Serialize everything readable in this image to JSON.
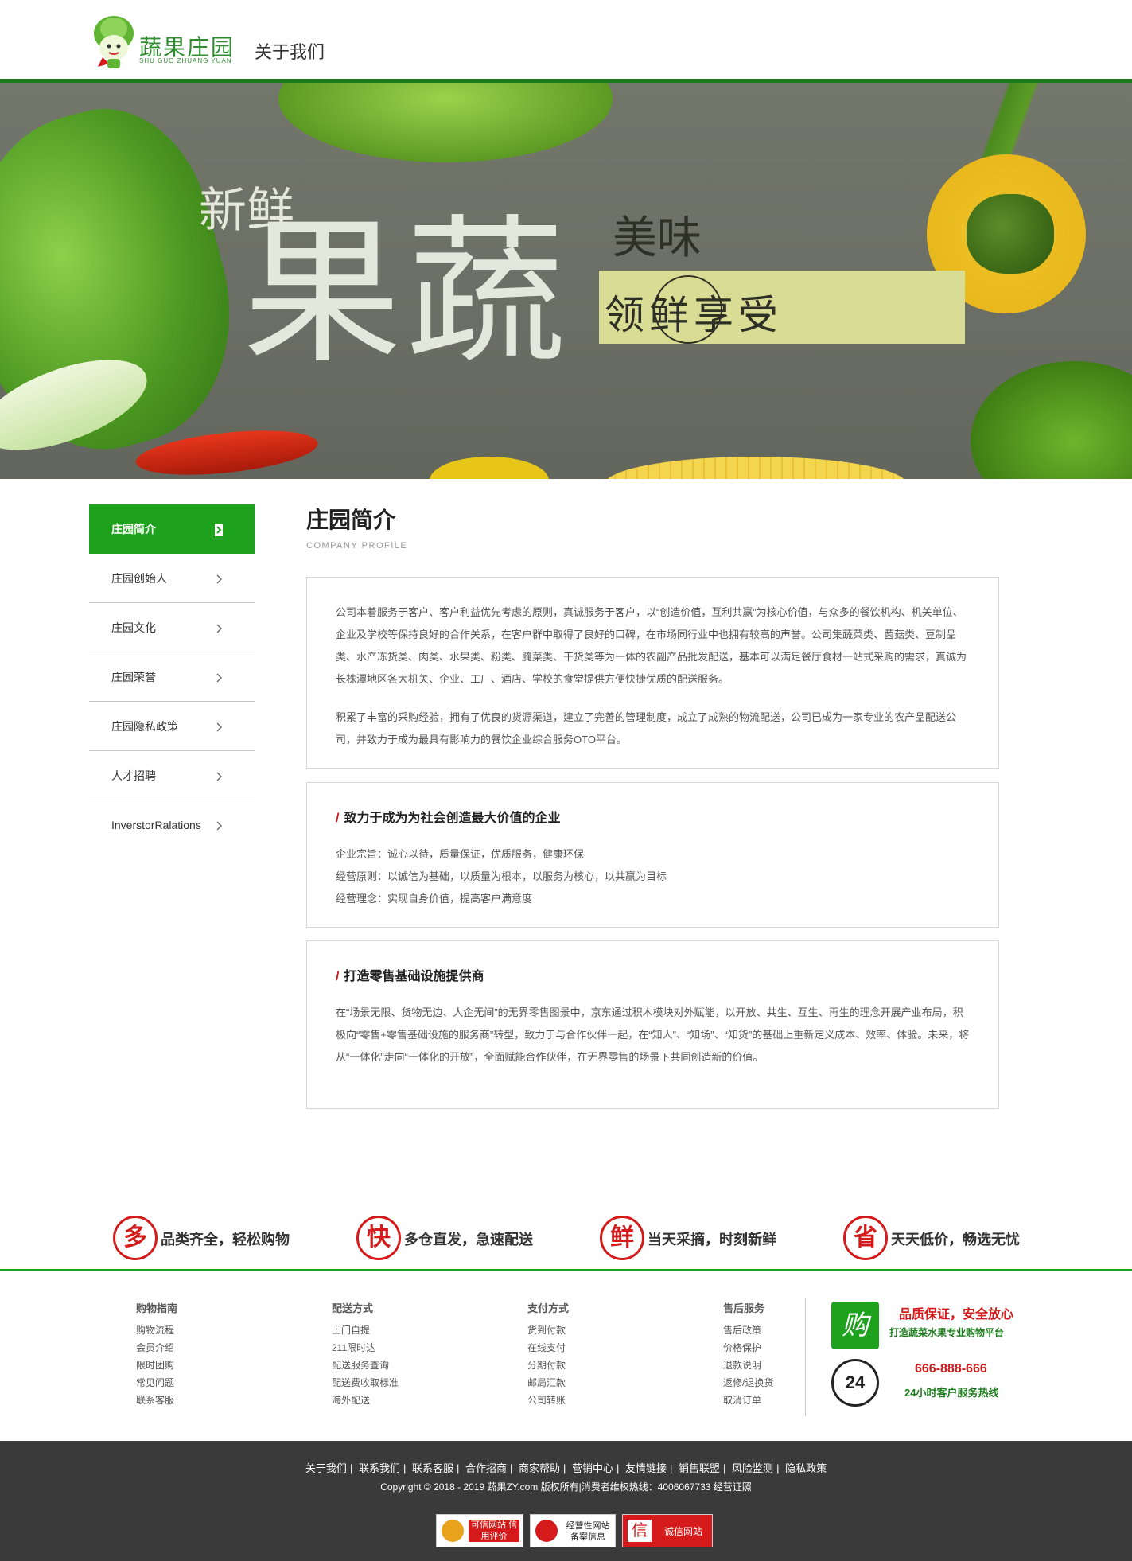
{
  "header": {
    "logo_text": "蔬果庄园",
    "logo_sub": "SHU GUO ZHUANG YUAN",
    "title": "关于我们"
  },
  "banner": {
    "line1": "新鲜",
    "line2": "果蔬",
    "line3": "美味",
    "slogan": "领鲜享受"
  },
  "sidebar": {
    "items": [
      {
        "label": "庄园简介",
        "active": true
      },
      {
        "label": "庄园创始人"
      },
      {
        "label": "庄园文化"
      },
      {
        "label": "庄园荣誉"
      },
      {
        "label": "庄园隐私政策"
      },
      {
        "label": "人才招聘"
      },
      {
        "label": "InverstorRalations"
      }
    ]
  },
  "main": {
    "title": "庄园简介",
    "subtitle": "COMPANY PROFILE",
    "intro_p1": "公司本着服务于客户、客户利益优先考虑的原则，真诚服务于客户，以“创造价值，互利共赢”为核心价值，与众多的餐饮机构、机关单位、企业及学校等保持良好的合作关系，在客户群中取得了良好的口碑，在市场同行业中也拥有较高的声誉。公司集蔬菜类、菌菇类、豆制品类、水产冻货类、肉类、水果类、粉类、腌菜类、干货类等为一体的农副产品批发配送，基本可以满足餐厅食材一站式采购的需求，真诚为长株潭地区各大机关、企业、工厂、酒店、学校的食堂提供方便快捷优质的配送服务。",
    "intro_p2": "积累了丰富的采购经验，拥有了优良的货源渠道，建立了完善的管理制度，成立了成熟的物流配送，公司已成为一家专业的农产品配送公司，并致力于成为最具有影响力的餐饮企业综合服务OTO平台。",
    "section2": {
      "heading": "致力于成为为社会创造最大价值的企业",
      "lines": [
        "企业宗旨：诚心以待，质量保证，优质服务，健康环保",
        "经营原则：以诚信为基础，以质量为根本，以服务为核心，以共赢为目标",
        "经营理念：实现自身价值，提高客户满意度"
      ]
    },
    "section3": {
      "heading": "打造零售基础设施提供商",
      "text": "在“场景无限、货物无边、人企无间”的无界零售图景中，京东通过积木模块对外赋能，以开放、共生、互生、再生的理念开展产业布局，积极向“零售+零售基础设施的服务商”转型，致力于与合作伙伴一起，在“知人”、“知场”、“知货”的基础上重新定义成本、效率、体验。未来，将从“一体化”走向“一体化的开放”，全面赋能合作伙伴，在无界零售的场景下共同创造新的价值。"
    }
  },
  "features": [
    {
      "char": "多",
      "text": "品类齐全，轻松购物"
    },
    {
      "char": "快",
      "text": "多仓直发，急速配送"
    },
    {
      "char": "鲜",
      "text": "当天采摘，时刻新鲜"
    },
    {
      "char": "省",
      "text": "天天低价，畅选无忧"
    }
  ],
  "footer_cols": [
    {
      "title": "购物指南",
      "items": [
        "购物流程",
        "会员介绍",
        "限时团购",
        "常见问题",
        "联系客服"
      ]
    },
    {
      "title": "配送方式",
      "items": [
        "上门自提",
        "211限时达",
        "配送服务查询",
        "配送费收取标准",
        "海外配送"
      ]
    },
    {
      "title": "支付方式",
      "items": [
        "货到付款",
        "在线支付",
        "分期付款",
        "邮局汇款",
        "公司转账"
      ]
    },
    {
      "title": "售后服务",
      "items": [
        "售后政策",
        "价格保护",
        "退款说明",
        "返修/退换货",
        "取消订单"
      ]
    }
  ],
  "footer_contact": {
    "badge_char": "购",
    "quality_title": "品质保证，安全放心",
    "quality_sub": "打造蔬菜水果专业购物平台",
    "phone_icon": "24",
    "phone": "666-888-666",
    "phone_sub": "24小时客户服务热线"
  },
  "bottom": {
    "nav": [
      "关于我们",
      "联系我们",
      "联系客服",
      "合作招商",
      "商家帮助",
      "营销中心",
      "友情链接",
      "销售联盟",
      "风险监测",
      "隐私政策"
    ],
    "copyright": "Copyright © 2018 - 2019 蔬果ZY.com 版权所有|消费者维权热线：4006067733 经营证照",
    "certs": [
      {
        "label": "可信网站 信用评价"
      },
      {
        "label": "经营性网站 备案信息"
      },
      {
        "label": "诚信网站"
      }
    ]
  }
}
